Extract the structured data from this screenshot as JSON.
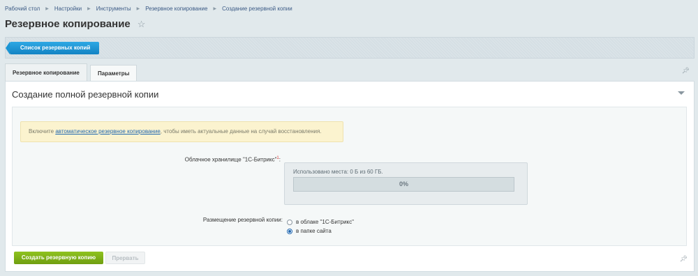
{
  "breadcrumb": [
    "Рабочий стол",
    "Настройки",
    "Инструменты",
    "Резервное копирование",
    "Создание резервной копии"
  ],
  "page_title": "Резервное копирование",
  "toolbar": {
    "list_button": "Список резервных копий"
  },
  "tabs": [
    {
      "label": "Резервное копирование"
    },
    {
      "label": "Параметры"
    }
  ],
  "panel": {
    "title": "Создание полной резервной копии",
    "notice": {
      "prefix": "Включите ",
      "link": "автоматическое резервное копирование",
      "suffix": ", чтобы иметь актуальные данные на случай восстановления."
    },
    "cloud_label": "Облачное хранилище \"1С-Битрикс\"",
    "cloud_marker": "1",
    "cloud_label_colon": ":",
    "cloud_used": "Использовано места: 0 Б из 60 ГБ.",
    "progress_text": "0%",
    "placement_label": "Размещение резервной копии:",
    "placement_options": [
      "в облаке \"1С-Битрикс\"",
      "в папке сайта"
    ],
    "placement_selected": 1
  },
  "buttons": {
    "create": "Создать резервную копию",
    "stop": "Прервать"
  },
  "colors": {
    "accent_blue": "#1383c3",
    "green": "#7fb31a",
    "notice_bg": "#fbf3cf"
  }
}
